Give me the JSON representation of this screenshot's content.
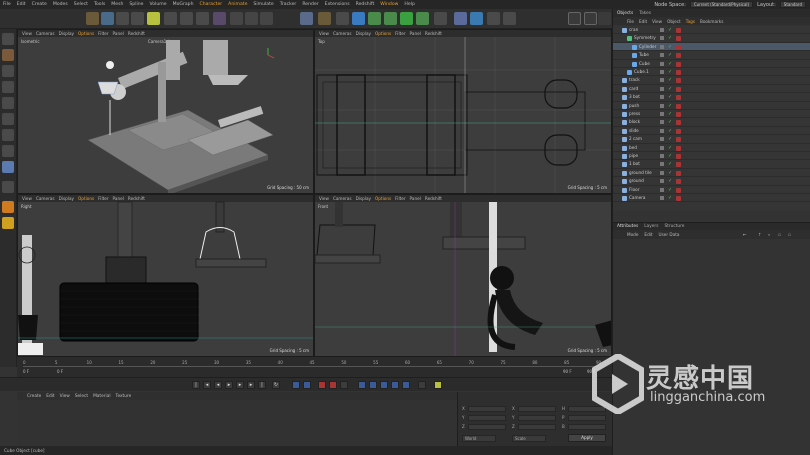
{
  "menubar": {
    "items": [
      "File",
      "Edit",
      "Create",
      "Modes",
      "Select",
      "Tools",
      "Mesh",
      "Spline",
      "Volume",
      "MoGraph",
      "Character",
      "Animate",
      "Simulate",
      "Tracker",
      "Render",
      "Extensions",
      "Redshift",
      "Window",
      "Help"
    ],
    "node_space_label": "Node Space:",
    "node_space_value": "Current (Standard/Physical)",
    "layout_label": "Layout:",
    "layout_value": "Standard"
  },
  "viewports": {
    "menu": [
      "View",
      "Cameras",
      "Display",
      "Options",
      "Filter",
      "Panel",
      "Redshift"
    ],
    "perspective": {
      "name": "Isometric",
      "camera_label": "Camera1 *",
      "grid": "Grid Spacing : 50 cm"
    },
    "top": {
      "name": "Top",
      "grid": "Grid Spacing : 5 cm"
    },
    "right": {
      "name": "Right",
      "grid": "Grid Spacing : 5 cm"
    },
    "front": {
      "name": "Front",
      "grid": "Grid Spacing : 5 cm"
    }
  },
  "timeline": {
    "ticks": [
      "0",
      "5",
      "10",
      "15",
      "20",
      "25",
      "30",
      "35",
      "40",
      "45",
      "50",
      "55",
      "60",
      "65",
      "70",
      "75",
      "80",
      "85",
      "90"
    ],
    "start_frame": "0 F",
    "cur_frame": "0 F",
    "end_frame": "90 F",
    "end_frame2": "90 F"
  },
  "material_manager": {
    "menu": [
      "Create",
      "Edit",
      "View",
      "Select",
      "Material",
      "Texture"
    ]
  },
  "coordinates": {
    "rows": [
      {
        "a": "X",
        "b": "X",
        "c": "H"
      },
      {
        "a": "Y",
        "b": "Y",
        "c": "P"
      },
      {
        "a": "Z",
        "b": "Z",
        "c": "B"
      }
    ],
    "mode1": "World",
    "mode2": "Scale",
    "apply": "Apply"
  },
  "status": {
    "text": "Cube Object [cube]"
  },
  "object_manager": {
    "tabs": [
      "Objects",
      "Takes"
    ],
    "menu": [
      "File",
      "Edit",
      "View",
      "Object",
      "Tags",
      "Bookmarks"
    ],
    "items": [
      {
        "name": "cran",
        "indent": 1,
        "color": "#8ab0e0"
      },
      {
        "name": "Symmetry",
        "indent": 2,
        "color": "#55c080"
      },
      {
        "name": "Cylinder",
        "indent": 3,
        "color": "#6aa8e8",
        "selected": true
      },
      {
        "name": "Tube",
        "indent": 3,
        "color": "#6aa8e8"
      },
      {
        "name": "Cube",
        "indent": 3,
        "color": "#6aa8e8"
      },
      {
        "name": "Cube.1",
        "indent": 2,
        "color": "#6aa8e8"
      },
      {
        "name": "track",
        "indent": 1,
        "color": "#8ab0e0"
      },
      {
        "name": "card",
        "indent": 1,
        "color": "#8ab0e0"
      },
      {
        "name": "3 bot",
        "indent": 1,
        "color": "#8ab0e0"
      },
      {
        "name": "push",
        "indent": 1,
        "color": "#8ab0e0"
      },
      {
        "name": "press",
        "indent": 1,
        "color": "#8ab0e0"
      },
      {
        "name": "block",
        "indent": 1,
        "color": "#8ab0e0"
      },
      {
        "name": "slide",
        "indent": 1,
        "color": "#8ab0e0"
      },
      {
        "name": "2 cam",
        "indent": 1,
        "color": "#8ab0e0"
      },
      {
        "name": "bed",
        "indent": 1,
        "color": "#8ab0e0"
      },
      {
        "name": "pipe",
        "indent": 1,
        "color": "#8ab0e0"
      },
      {
        "name": "1 bot",
        "indent": 1,
        "color": "#8ab0e0"
      },
      {
        "name": "ground tile",
        "indent": 1,
        "color": "#8ab0e0"
      },
      {
        "name": "ground",
        "indent": 1,
        "color": "#8ab0e0"
      },
      {
        "name": "Floor",
        "indent": 1,
        "color": "#8ab0e0"
      },
      {
        "name": "Camera",
        "indent": 1,
        "color": "#8ab0e0"
      }
    ]
  },
  "attributes": {
    "tabs": [
      "Attributes",
      "Layers",
      "Structure"
    ],
    "menu": [
      "Mode",
      "Edit",
      "User Data"
    ]
  },
  "watermark": {
    "cn": "灵感中国",
    "en": "lingganchina.com"
  }
}
